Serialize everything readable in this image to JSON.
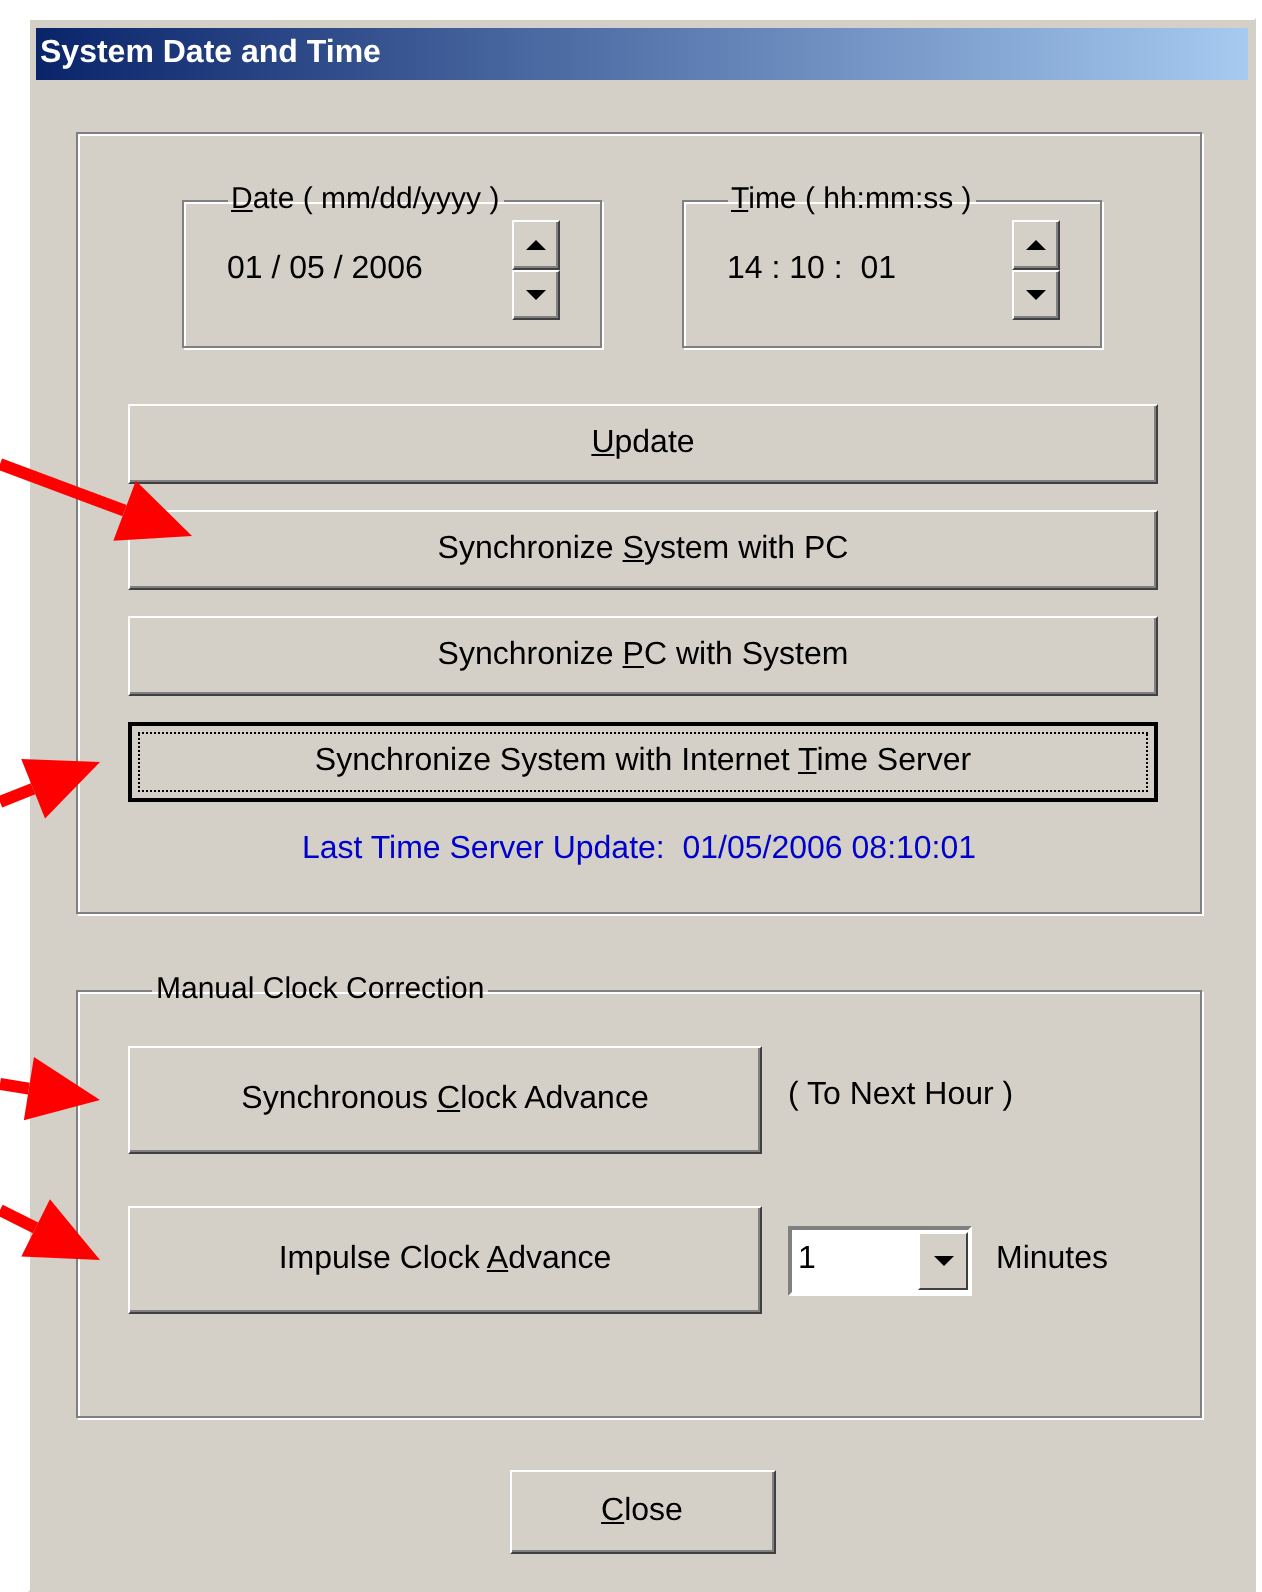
{
  "window": {
    "title": "System Date and Time"
  },
  "date": {
    "label": {
      "key": "D",
      "after": "ate ( mm/dd/yyyy )"
    },
    "value": "01 / 05 / 2006"
  },
  "time": {
    "label": {
      "key": "T",
      "after": "ime ( hh:mm:ss )"
    },
    "value": "14 : 10 :  01"
  },
  "buttons": [
    {
      "label": {
        "key": "U",
        "after": "pdate"
      },
      "default": false
    },
    {
      "label": {
        "before": "Synchronize ",
        "key": "S",
        "after": "ystem with PC"
      },
      "default": false,
      "marked": true
    },
    {
      "label": {
        "before": "Synchronize ",
        "key": "P",
        "after": "C with System"
      },
      "default": false
    },
    {
      "label": {
        "before": "Synchronize System with Internet ",
        "key": "T",
        "after": "ime Server"
      },
      "default": true,
      "marked": true
    }
  ],
  "last_update": "Last Time Server Update:  01/05/2006 08:10:01",
  "manual": {
    "title": "Manual Clock Correction",
    "rows": [
      {
        "kind": "note",
        "button": {
          "label": {
            "before": "Synchronous ",
            "key": "C",
            "after": "lock Advance"
          },
          "default": false,
          "marked": true
        },
        "note": "( To Next Hour )"
      },
      {
        "kind": "combo",
        "button": {
          "label": {
            "before": "Impulse Clock ",
            "key": "A",
            "after": "dvance"
          },
          "default": false,
          "marked": true
        },
        "value": "1",
        "unit": "Minutes"
      }
    ]
  },
  "close": {
    "label": {
      "key": "C",
      "after": "lose"
    },
    "default": false
  }
}
